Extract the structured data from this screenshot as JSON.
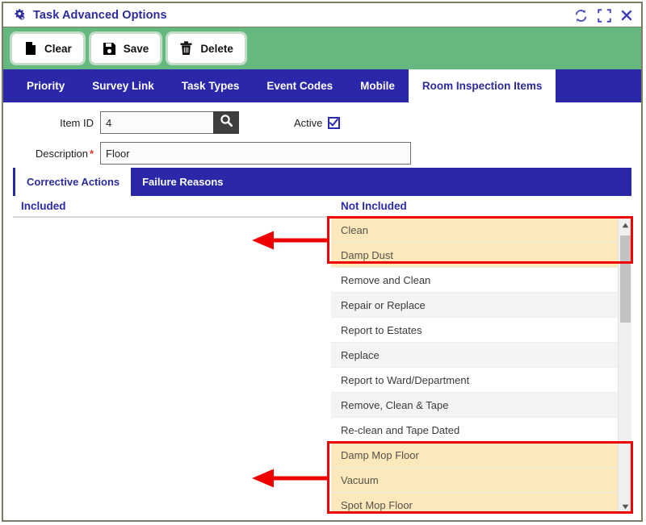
{
  "window": {
    "title": "Task Advanced Options",
    "icons": {
      "title": "gears-icon",
      "refresh": "refresh-icon",
      "expand": "expand-icon",
      "close": "close-icon"
    }
  },
  "toolbar": {
    "buttons": [
      {
        "label": "Clear",
        "icon": "file-icon"
      },
      {
        "label": "Save",
        "icon": "floppy-disk-icon"
      },
      {
        "label": "Delete",
        "icon": "trash-icon"
      }
    ]
  },
  "tabs": [
    {
      "label": "Priority",
      "active": false
    },
    {
      "label": "Survey Link",
      "active": false
    },
    {
      "label": "Task Types",
      "active": false
    },
    {
      "label": "Event Codes",
      "active": false
    },
    {
      "label": "Mobile",
      "active": false
    },
    {
      "label": "Room Inspection Items",
      "active": true
    }
  ],
  "form": {
    "item_id_label": "Item ID",
    "item_id_value": "4",
    "item_id_placeholder": "",
    "search_icon": "magnifier-icon",
    "active_label": "Active",
    "active_checked": true,
    "description_label": "Description",
    "description_required_marker": "*",
    "description_value": "Floor",
    "description_placeholder": ""
  },
  "subtabs": [
    {
      "label": "Corrective Actions",
      "active": true
    },
    {
      "label": "Failure Reasons",
      "active": false
    }
  ],
  "panes": {
    "included_title": "Included",
    "not_included_title": "Not Included",
    "included_items": [],
    "not_included_items": [
      {
        "label": "Clean",
        "highlighted": true
      },
      {
        "label": "Damp Dust",
        "highlighted": true
      },
      {
        "label": "Remove and Clean",
        "highlighted": false
      },
      {
        "label": "Repair or Replace",
        "highlighted": false
      },
      {
        "label": "Report to Estates",
        "highlighted": false
      },
      {
        "label": "Replace",
        "highlighted": false
      },
      {
        "label": "Report to Ward/Department",
        "highlighted": false
      },
      {
        "label": "Remove, Clean & Tape",
        "highlighted": false
      },
      {
        "label": "Re-clean and Tape Dated",
        "highlighted": false
      },
      {
        "label": "Damp Mop Floor",
        "highlighted": true
      },
      {
        "label": "Vacuum",
        "highlighted": true
      },
      {
        "label": "Spot Mop Floor",
        "highlighted": true
      }
    ],
    "scrollbar": {
      "up_icon": "triangle-up-icon",
      "down_icon": "triangle-down-icon"
    }
  },
  "annotations": {
    "color": "#ee0000",
    "boxes": [
      {
        "name": "annotation-box-top"
      },
      {
        "name": "annotation-box-bottom"
      }
    ],
    "arrows": [
      {
        "name": "annotation-arrow-top"
      },
      {
        "name": "annotation-arrow-bottom"
      }
    ]
  },
  "colors": {
    "title_text": "#2b2b9c",
    "toolbar_bg": "#66b97e",
    "tab_bg": "#2a28a8",
    "highlight_row": "#fce9bb",
    "annotation": "#ee0000"
  }
}
